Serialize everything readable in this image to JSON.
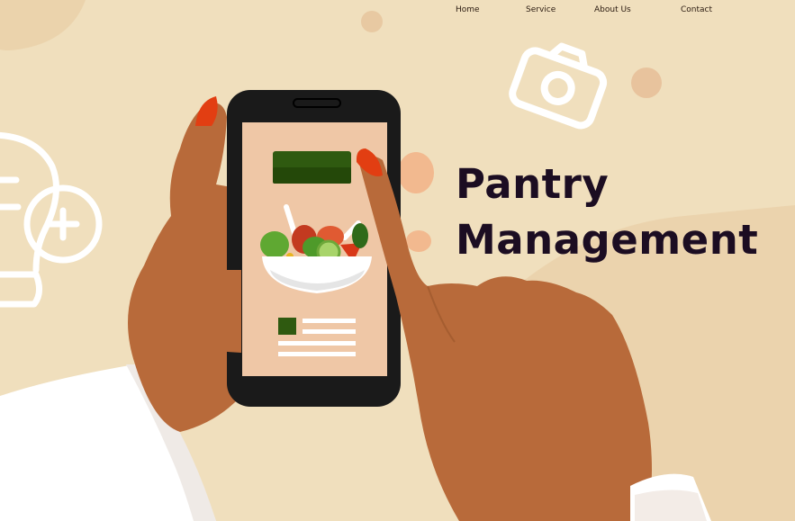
{
  "nav": {
    "items": [
      {
        "label": "Home"
      },
      {
        "label": "Service"
      },
      {
        "label": "About Us"
      },
      {
        "label": "Contact"
      }
    ]
  },
  "hero": {
    "title_line1": "Pantry",
    "title_line2": "Management"
  },
  "colors": {
    "background": "#f0dfbd",
    "skin": "#b86a3a",
    "nail": "#e23e12",
    "phone": "#1a1a1a",
    "screen": "#efc7a6",
    "accent_green": "#2f5a10",
    "title": "#1c0d22",
    "sleeve": "#ffffff"
  },
  "icons": [
    "camera-icon",
    "lightbulb-icon",
    "plus-circle-icon",
    "salad-bowl-icon"
  ]
}
